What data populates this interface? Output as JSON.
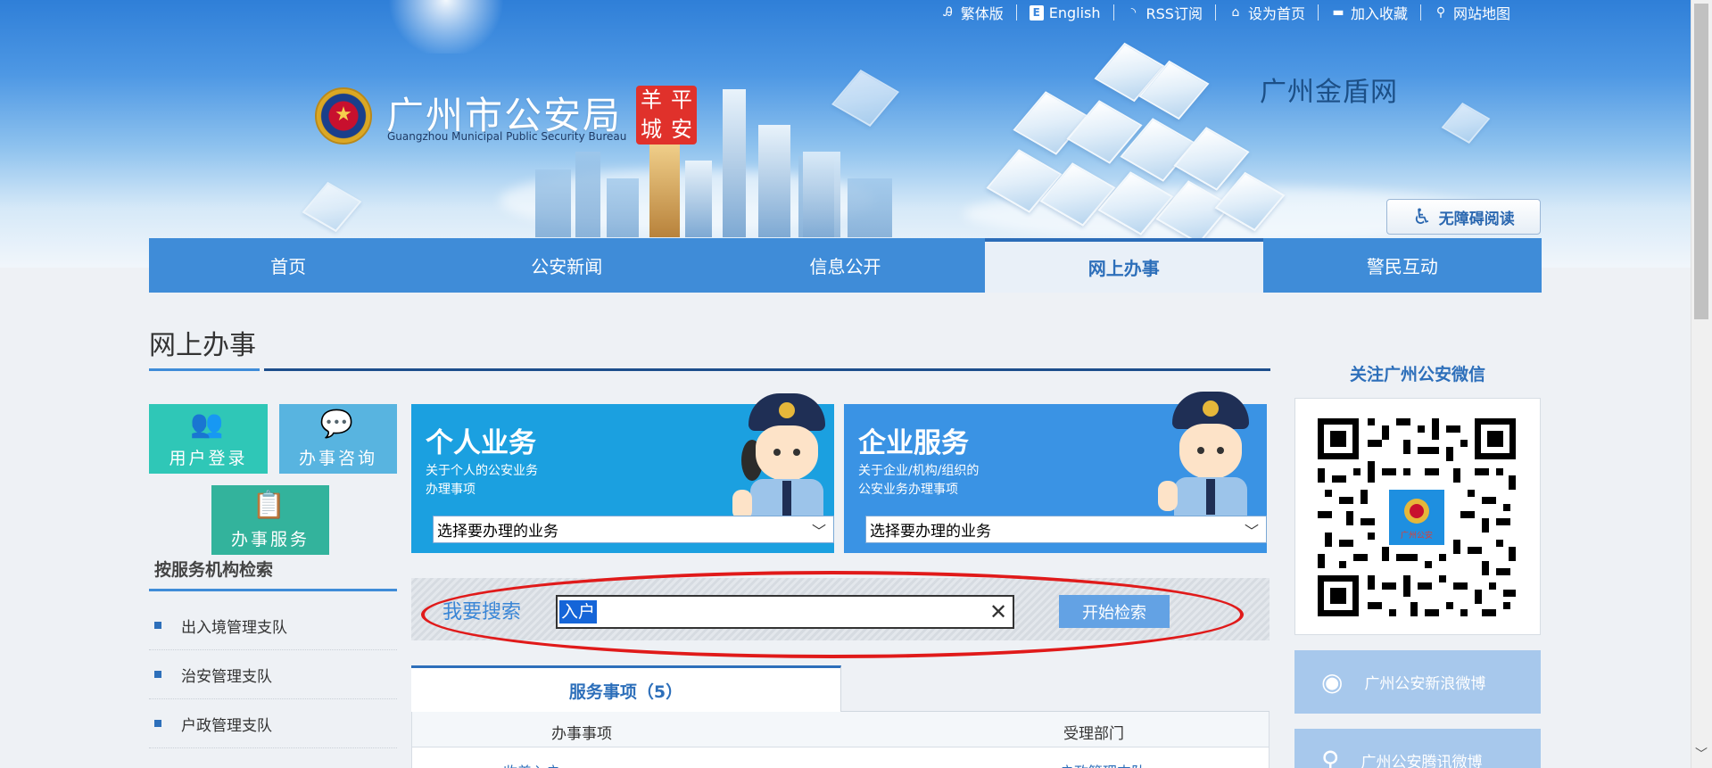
{
  "top_links": [
    {
      "label": "繁体版",
      "icon": "translate-icon"
    },
    {
      "label": "English",
      "icon": "english-icon"
    },
    {
      "label": "RSS订阅",
      "icon": "rss-icon"
    },
    {
      "label": "设为首页",
      "icon": "home-icon"
    },
    {
      "label": "加入收藏",
      "icon": "folder-icon"
    },
    {
      "label": "网站地图",
      "icon": "map-pin-icon"
    }
  ],
  "header": {
    "logo_title": "广州市公安局",
    "logo_subtitle": "Guangzhou Municipal Public Security Bureau",
    "seal_chars": [
      "羊",
      "平",
      "城",
      "安"
    ],
    "site_name": "广州金盾网",
    "accessibility_label": "无障碍阅读"
  },
  "nav": {
    "items": [
      "首页",
      "公安新闻",
      "信息公开",
      "网上办事",
      "警民互动"
    ],
    "active": "网上办事"
  },
  "page": {
    "title": "网上办事"
  },
  "left": {
    "tiles": {
      "login": "用户登录",
      "consult": "办事咨询",
      "service": "办事服务"
    },
    "org_heading": "按服务机构检索",
    "orgs": [
      "出入境管理支队",
      "治安管理支队",
      "户政管理支队"
    ]
  },
  "cards": {
    "personal": {
      "title": "个人业务",
      "desc_line1": "关于个人的公安业务",
      "desc_line2": "办理事项",
      "select_value": "选择要办理的业务"
    },
    "enterprise": {
      "title": "企业服务",
      "desc_line1": "关于企业/机构/组织的",
      "desc_line2": "公安业务办理事项",
      "select_value": "选择要办理的业务"
    }
  },
  "search": {
    "label": "我要搜索",
    "value": "入户",
    "button": "开始检索"
  },
  "results": {
    "tab_label": "服务事项（5）",
    "columns": [
      "办事事项",
      "受理部门"
    ],
    "rows": [
      {
        "item": "收养入户",
        "dept": "户政管理支队"
      }
    ]
  },
  "right": {
    "wechat_title": "关注广州公安微信",
    "qr_center_label": "广州公安",
    "social": [
      {
        "label": "广州公安新浪微博",
        "icon": "weibo-icon"
      },
      {
        "label": "广州公安腾讯微博",
        "icon": "tencent-weibo-icon"
      }
    ]
  },
  "colors": {
    "nav_blue": "#3f8cd8",
    "dark_blue": "#1d4e8c",
    "teal": "#2fc7b7",
    "highlight_red": "#e01a1a"
  }
}
